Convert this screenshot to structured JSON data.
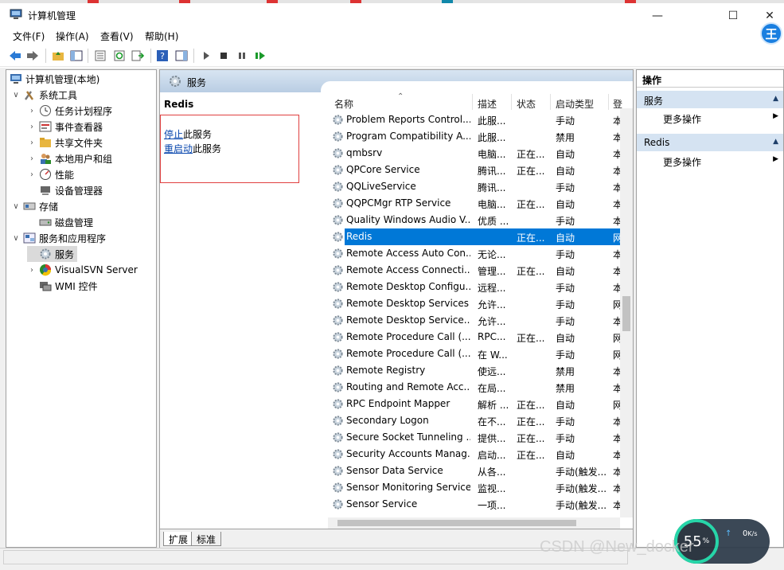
{
  "window": {
    "title": "计算机管理",
    "controls": [
      "—",
      "☐",
      "✕"
    ]
  },
  "menu": [
    "文件(F)",
    "操作(A)",
    "查看(V)",
    "帮助(H)"
  ],
  "user_badge": "王",
  "tree": [
    {
      "label": "计算机管理(本地)",
      "level": 0,
      "twisty": "",
      "icon": "computer-management-icon"
    },
    {
      "label": "系统工具",
      "level": 1,
      "twisty": "∨",
      "icon": "system-tools-icon"
    },
    {
      "label": "任务计划程序",
      "level": 2,
      "twisty": "›",
      "icon": "task-scheduler-icon"
    },
    {
      "label": "事件查看器",
      "level": 2,
      "twisty": "›",
      "icon": "event-viewer-icon"
    },
    {
      "label": "共享文件夹",
      "level": 2,
      "twisty": "›",
      "icon": "shared-folders-icon"
    },
    {
      "label": "本地用户和组",
      "level": 2,
      "twisty": "›",
      "icon": "local-users-icon"
    },
    {
      "label": "性能",
      "level": 2,
      "twisty": "›",
      "icon": "performance-icon"
    },
    {
      "label": "设备管理器",
      "level": 2,
      "twisty": "",
      "icon": "device-manager-icon"
    },
    {
      "label": "存储",
      "level": 1,
      "twisty": "∨",
      "icon": "storage-icon"
    },
    {
      "label": "磁盘管理",
      "level": 2,
      "twisty": "",
      "icon": "disk-management-icon"
    },
    {
      "label": "服务和应用程序",
      "level": 1,
      "twisty": "∨",
      "icon": "services-apps-icon"
    },
    {
      "label": "服务",
      "level": 2,
      "twisty": "",
      "icon": "services-icon",
      "selected": true
    },
    {
      "label": "VisualSVN Server",
      "level": 2,
      "twisty": "›",
      "icon": "visualsvn-icon"
    },
    {
      "label": "WMI 控件",
      "level": 2,
      "twisty": "",
      "icon": "wmi-control-icon"
    }
  ],
  "center": {
    "header_title": "服务",
    "selected_service": "Redis",
    "links": [
      {
        "link": "停止",
        "rest": "此服务"
      },
      {
        "link": "重启动",
        "rest": "此服务"
      }
    ],
    "columns": [
      "名称",
      "描述",
      "状态",
      "启动类型",
      "登"
    ],
    "rows": [
      {
        "name": "Problem Reports Control...",
        "desc": "此服...",
        "status": "",
        "startup": "手动",
        "logon": "本"
      },
      {
        "name": "Program Compatibility A...",
        "desc": "此服...",
        "status": "",
        "startup": "禁用",
        "logon": "本"
      },
      {
        "name": "qmbsrv",
        "desc": "电脑...",
        "status": "正在...",
        "startup": "自动",
        "logon": "本"
      },
      {
        "name": "QPCore Service",
        "desc": "腾讯...",
        "status": "正在...",
        "startup": "自动",
        "logon": "本"
      },
      {
        "name": "QQLiveService",
        "desc": "腾讯...",
        "status": "",
        "startup": "手动",
        "logon": "本"
      },
      {
        "name": "QQPCMgr RTP Service",
        "desc": "电脑...",
        "status": "正在...",
        "startup": "自动",
        "logon": "本"
      },
      {
        "name": "Quality Windows Audio V...",
        "desc": "优质 ...",
        "status": "",
        "startup": "手动",
        "logon": "本"
      },
      {
        "name": "Redis",
        "desc": "",
        "status": "正在...",
        "startup": "自动",
        "logon": "网",
        "selected": true
      },
      {
        "name": "Remote Access Auto Con...",
        "desc": "无论...",
        "status": "",
        "startup": "手动",
        "logon": "本"
      },
      {
        "name": "Remote Access Connecti...",
        "desc": "管理...",
        "status": "正在...",
        "startup": "自动",
        "logon": "本"
      },
      {
        "name": "Remote Desktop Configu...",
        "desc": "远程...",
        "status": "",
        "startup": "手动",
        "logon": "本"
      },
      {
        "name": "Remote Desktop Services",
        "desc": "允许...",
        "status": "",
        "startup": "手动",
        "logon": "网"
      },
      {
        "name": "Remote Desktop Service...",
        "desc": "允许...",
        "status": "",
        "startup": "手动",
        "logon": "本"
      },
      {
        "name": "Remote Procedure Call (...",
        "desc": "RPC...",
        "status": "正在...",
        "startup": "自动",
        "logon": "网"
      },
      {
        "name": "Remote Procedure Call (...",
        "desc": "在 W...",
        "status": "",
        "startup": "手动",
        "logon": "网"
      },
      {
        "name": "Remote Registry",
        "desc": "使远...",
        "status": "",
        "startup": "禁用",
        "logon": "本"
      },
      {
        "name": "Routing and Remote Acc...",
        "desc": "在局...",
        "status": "",
        "startup": "禁用",
        "logon": "本"
      },
      {
        "name": "RPC Endpoint Mapper",
        "desc": "解析 ...",
        "status": "正在...",
        "startup": "自动",
        "logon": "网"
      },
      {
        "name": "Secondary Logon",
        "desc": "在不...",
        "status": "正在...",
        "startup": "手动",
        "logon": "本"
      },
      {
        "name": "Secure Socket Tunneling ...",
        "desc": "提供...",
        "status": "正在...",
        "startup": "手动",
        "logon": "本"
      },
      {
        "name": "Security Accounts Manag...",
        "desc": "启动...",
        "status": "正在...",
        "startup": "自动",
        "logon": "本"
      },
      {
        "name": "Sensor Data Service",
        "desc": "从各...",
        "status": "",
        "startup": "手动(触发...",
        "logon": "本"
      },
      {
        "name": "Sensor Monitoring Service",
        "desc": "监视...",
        "status": "",
        "startup": "手动(触发...",
        "logon": "本"
      },
      {
        "name": "Sensor Service",
        "desc": "一项...",
        "status": "",
        "startup": "手动(触发...",
        "logon": "本"
      }
    ],
    "tabs": [
      "扩展",
      "标准"
    ]
  },
  "actions": {
    "title": "操作",
    "sections": [
      {
        "label": "服务",
        "item": "更多操作"
      },
      {
        "label": "Redis",
        "item": "更多操作"
      }
    ]
  },
  "net_widget": {
    "value": "55",
    "unit": "%",
    "upload": "0",
    "upload_unit": "K/s"
  },
  "watermark": "CSDN @New_docker",
  "colors": {
    "selection": "#0078d7",
    "header_gradient_top": "#d8e5f2",
    "section_bg": "#d5e3f2",
    "red_box": "#e04040",
    "link": "#0645ad"
  }
}
